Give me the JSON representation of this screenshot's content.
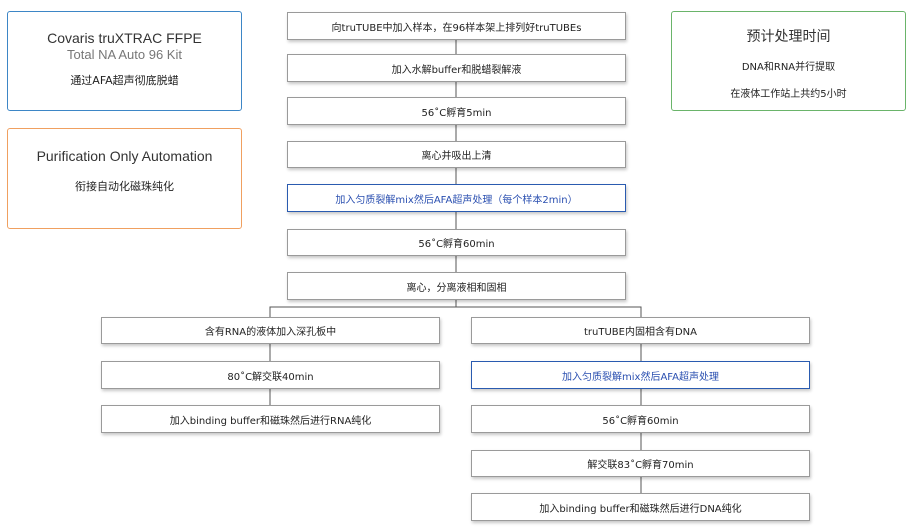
{
  "cards": {
    "covaris": {
      "title": "Covaris truXTRAC FFPE",
      "subtitle": "Total NA Auto 96 Kit",
      "desc": "通过AFA超声彻底脱蜡",
      "border": "#3d86c6"
    },
    "purification": {
      "title": "Purification Only Automation",
      "desc": "衔接自动化磁珠纯化",
      "border": "#f0a060"
    },
    "timing": {
      "title": "预计处理时间",
      "line1": "DNA和RNA并行提取",
      "line2": "在液体工作站上共约5小时",
      "border": "#6ab46a"
    }
  },
  "steps": [
    "向truTUBE中加入样本，在96样本架上排列好truTUBEs",
    "加入水解buffer和脱蜡裂解液",
    "56˚C孵育5min",
    "离心并吸出上清",
    "加入匀质裂解mix然后AFA超声处理（每个样本2min）",
    "56˚C孵育60min",
    "离心，分离液相和固相"
  ],
  "rna_branch": [
    "含有RNA的液体加入深孔板中",
    "80˚C解交联40min",
    "加入binding buffer和磁珠然后进行RNA纯化"
  ],
  "dna_branch": [
    "truTUBE内固相含有DNA",
    "加入匀质裂解mix然后AFA超声处理",
    "56˚C孵育60min",
    "解交联83˚C孵育70min",
    "加入binding buffer和磁珠然后进行DNA纯化"
  ],
  "colors": {
    "highlight": "#2a5bb0",
    "box_border": "#9a9a9a",
    "line": "#555555"
  }
}
